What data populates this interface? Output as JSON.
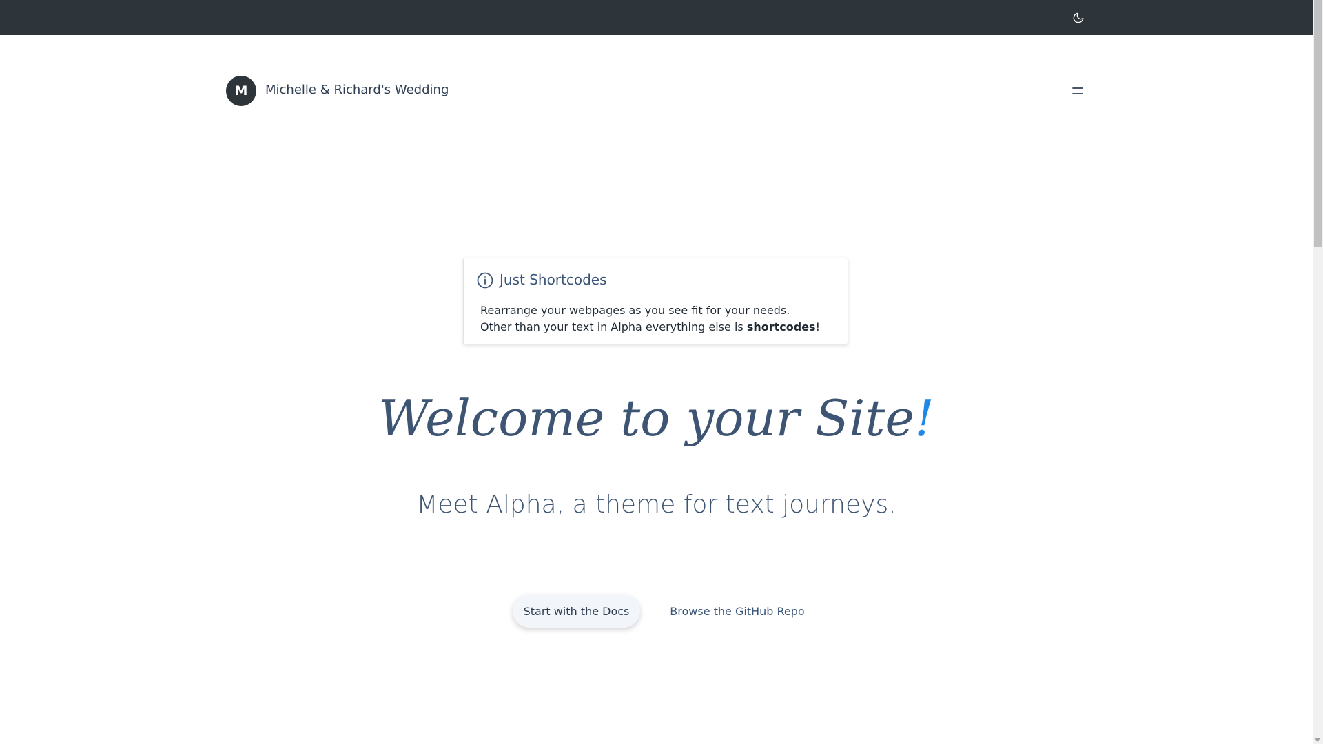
{
  "topbar": {
    "theme_toggle_icon": "moon-icon"
  },
  "header": {
    "logo_letter": "M",
    "site_title": "Michelle & Richard's Wedding",
    "menu_icon": "menu-icon"
  },
  "callout": {
    "icon": "info-icon",
    "title": "Just Shortcodes",
    "line1": "Rearrange your webpages as you see fit for your needs.",
    "line2_prefix": "Other than your text in Alpha everything else is ",
    "line2_bold": "shortcodes",
    "line2_suffix": "!"
  },
  "hero": {
    "title": "Welcome to your Site",
    "title_punct": "!",
    "subtitle": "Meet Alpha, a theme for text journeys."
  },
  "actions": {
    "primary_label": "Start with the Docs",
    "secondary_label": "Browse the GitHub Repo"
  },
  "colors": {
    "topbar_bg": "#2d353b",
    "text": "#3d5573",
    "accent": "#1e88e5"
  }
}
